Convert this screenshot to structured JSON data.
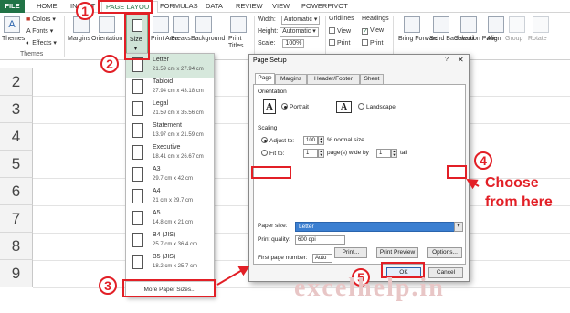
{
  "ribbon_tabs": [
    "FILE",
    "HOME",
    "INSERT",
    "PAGE LAYOUT",
    "FORMULAS",
    "DATA",
    "REVIEW",
    "VIEW",
    "POWERPIVOT"
  ],
  "ribbon": {
    "themes": "Themes",
    "themes_group": "Themes",
    "colors": "Colors",
    "fonts": "Fonts",
    "effects": "Effects",
    "margins": "Margins",
    "orientation": "Orientation",
    "size": "Size",
    "print_area": "Print Area",
    "breaks": "Breaks",
    "background": "Background",
    "print_titles": "Print Titles",
    "width_label": "Width:",
    "width_value": "Automatic",
    "height_label": "Height:",
    "height_value": "Automatic",
    "scale_label": "Scale:",
    "scale_value": "100%",
    "gridlines": "Gridlines",
    "headings": "Headings",
    "view": "View",
    "print": "Print",
    "bring_forward": "Bring Forward",
    "send_backward": "Send Backward",
    "selection_pane": "Selection Pane",
    "align": "Align",
    "group": "Group",
    "rotate": "Rotate"
  },
  "rows": [
    "2",
    "3",
    "4",
    "5",
    "6",
    "7",
    "8",
    "9"
  ],
  "size_menu": {
    "items": [
      {
        "name": "Letter",
        "dims": "21.59 cm x 27.94 cm"
      },
      {
        "name": "Tabloid",
        "dims": "27.94 cm x 43.18 cm"
      },
      {
        "name": "Legal",
        "dims": "21.59 cm x 35.56 cm"
      },
      {
        "name": "Statement",
        "dims": "13.97 cm x 21.59 cm"
      },
      {
        "name": "Executive",
        "dims": "18.41 cm x 26.67 cm"
      },
      {
        "name": "A3",
        "dims": "29.7 cm x 42 cm"
      },
      {
        "name": "A4",
        "dims": "21 cm x 29.7 cm"
      },
      {
        "name": "A5",
        "dims": "14.8 cm x 21 cm"
      },
      {
        "name": "B4 (JIS)",
        "dims": "25.7 cm x 36.4 cm"
      },
      {
        "name": "B5 (JIS)",
        "dims": "18.2 cm x 25.7 cm"
      }
    ],
    "more": "More Paper Sizes..."
  },
  "dialog": {
    "title": "Page Setup",
    "help": "?",
    "close": "✕",
    "tabs": [
      "Page",
      "Margins",
      "Header/Footer",
      "Sheet"
    ],
    "orientation_label": "Orientation",
    "portrait": "Portrait",
    "landscape": "Landscape",
    "scaling_label": "Scaling",
    "adjust_to": "Adjust to:",
    "adjust_value": "100",
    "normal_size": "% normal size",
    "fit_to": "Fit to:",
    "fit_wide_value": "1",
    "pages_wide_by": "page(s) wide by",
    "fit_tall_value": "1",
    "tall": "tall",
    "paper_size_label": "Paper size:",
    "paper_size_value": "Letter",
    "print_quality_label": "Print quality:",
    "print_quality_value": "600 dpi",
    "first_page_label": "First page number:",
    "first_page_value": "Auto",
    "print_btn": "Print...",
    "preview_btn": "Print Preview",
    "options_btn": "Options...",
    "ok_btn": "OK",
    "cancel_btn": "Cancel"
  },
  "annotations": {
    "step1": "1",
    "step2": "2",
    "step3": "3",
    "step4": "4",
    "step5": "5",
    "choose_line1": "Choose",
    "choose_line2": "from here",
    "color": "#e21f26"
  },
  "watermark": "excelhelp.in",
  "colors": {
    "excel_green": "#217346",
    "selection_blue": "#3b7fd1"
  }
}
